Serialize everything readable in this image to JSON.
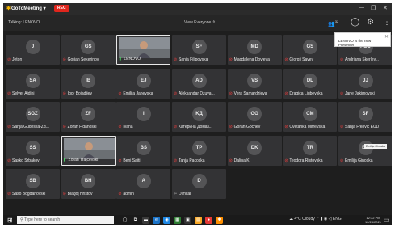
{
  "titlebar": {
    "app_name": "GoToMeeting",
    "rec_label": "REC",
    "minimize": "—",
    "restore": "❐",
    "close": "✕"
  },
  "toolbar": {
    "talking": "Talking: LENOVO",
    "view": "View Everyone",
    "attendee_count": "32"
  },
  "notification": {
    "text": "LENOVO is the new Presenter",
    "close": "✕"
  },
  "tooltip": "Emilija Ginoska",
  "participants": [
    {
      "initials": "J",
      "name": "Jeton",
      "mic": "muted"
    },
    {
      "initials": "GS",
      "name": "Gorjan Sekerinov",
      "mic": "muted"
    },
    {
      "initials": "",
      "name": "LENOVO",
      "mic": "on",
      "video": true
    },
    {
      "initials": "SF",
      "name": "Sanja Filipovska",
      "mic": "muted"
    },
    {
      "initials": "MD",
      "name": "Magdalena Dovleva",
      "mic": "muted"
    },
    {
      "initials": "GS",
      "name": "Gjorgji Savev",
      "mic": "muted"
    },
    {
      "initials": "ASC",
      "name": "Andriana Skerlev...",
      "mic": "muted"
    },
    {
      "initials": "SA",
      "name": "Selver Ajdini",
      "mic": "muted"
    },
    {
      "initials": "IB",
      "name": "Igor Bojadjiev",
      "mic": "muted"
    },
    {
      "initials": "EJ",
      "name": "Emilija Janevska",
      "mic": "muted"
    },
    {
      "initials": "AD",
      "name": "Aleksandar Dzuva...",
      "mic": "muted"
    },
    {
      "initials": "VS",
      "name": "Vera Samardzieva",
      "mic": "muted"
    },
    {
      "initials": "DL",
      "name": "Dragica Ljubevska",
      "mic": "muted"
    },
    {
      "initials": "JJ",
      "name": "Jane Jakimovski",
      "mic": "muted"
    },
    {
      "initials": "SGZ",
      "name": "Sanja Gudeska-Zd...",
      "mic": "muted"
    },
    {
      "initials": "ZF",
      "name": "Zoran Fidanoski",
      "mic": "muted"
    },
    {
      "initials": "I",
      "name": "Ivana",
      "mic": "muted"
    },
    {
      "initials": "KД",
      "name": "Катерина Домаз...",
      "mic": "muted"
    },
    {
      "initials": "GG",
      "name": "Goran Gochev",
      "mic": "muted"
    },
    {
      "initials": "CM",
      "name": "Cvetanka Mitrevska",
      "mic": "muted"
    },
    {
      "initials": "SF",
      "name": "Sanja Frkovic EUD",
      "mic": "muted"
    },
    {
      "initials": "SS",
      "name": "Sasko Srbakov",
      "mic": "muted"
    },
    {
      "initials": "",
      "name": "Zoran Trajcevski",
      "mic": "on",
      "video": true
    },
    {
      "initials": "BS",
      "name": "Beni Saiti",
      "mic": "muted"
    },
    {
      "initials": "TP",
      "name": "Tanja Pacoska",
      "mic": "muted"
    },
    {
      "initials": "DK",
      "name": "Dalina K.",
      "mic": "muted"
    },
    {
      "initials": "TR",
      "name": "Teodora Ristovska",
      "mic": "muted"
    },
    {
      "initials": "EG",
      "name": "Emilija Ginoska",
      "mic": "muted"
    },
    {
      "initials": "SB",
      "name": "Sašo Bogdanovski",
      "mic": "muted"
    },
    {
      "initials": "BH",
      "name": "Blagoj Hristov",
      "mic": "muted"
    },
    {
      "initials": "A",
      "name": "admin",
      "mic": "muted"
    },
    {
      "initials": "D",
      "name": "Dimitar",
      "mic": "none"
    }
  ],
  "taskbar": {
    "search_placeholder": "Type here to search",
    "weather": "4°C Cloudy",
    "language": "ENG",
    "time": "12:32 PM",
    "date": "12/24/2021"
  }
}
